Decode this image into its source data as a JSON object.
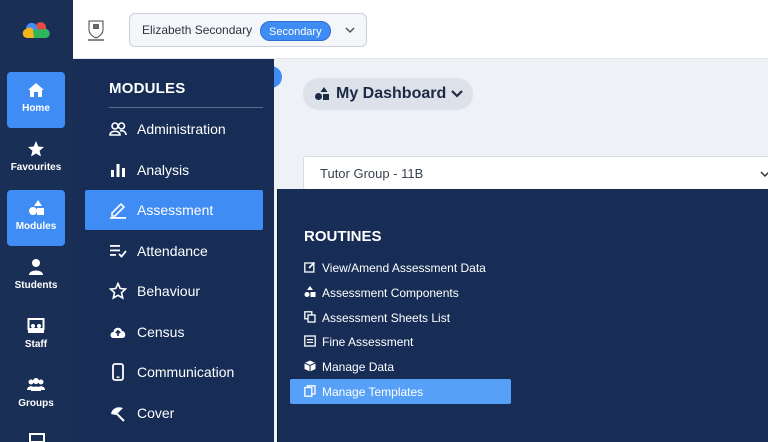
{
  "topbar": {
    "school_name": "Elizabeth Secondary",
    "school_phase": "Secondary"
  },
  "rail": {
    "items": [
      {
        "label": "Home",
        "icon": "home-icon"
      },
      {
        "label": "Favourites",
        "icon": "star-icon"
      },
      {
        "label": "Modules",
        "icon": "shapes-icon"
      },
      {
        "label": "Students",
        "icon": "user-icon"
      },
      {
        "label": "Staff",
        "icon": "staff-icon"
      },
      {
        "label": "Groups",
        "icon": "users-icon"
      }
    ]
  },
  "dashboard": {
    "title": "My Dashboard",
    "tutor_group": "Tutor Group - 11B"
  },
  "modules": {
    "title": "MODULES",
    "items": [
      {
        "label": "Administration",
        "icon": "admin-icon"
      },
      {
        "label": "Analysis",
        "icon": "bar-chart-icon"
      },
      {
        "label": "Assessment",
        "icon": "pencil-icon"
      },
      {
        "label": "Attendance",
        "icon": "checklist-icon"
      },
      {
        "label": "Behaviour",
        "icon": "star-outline-icon"
      },
      {
        "label": "Census",
        "icon": "cloud-upload-icon"
      },
      {
        "label": "Communication",
        "icon": "mobile-icon"
      },
      {
        "label": "Cover",
        "icon": "cover-icon"
      }
    ]
  },
  "routines": {
    "title": "ROUTINES",
    "items": [
      {
        "label": "View/Amend Assessment Data",
        "icon": "edit-icon"
      },
      {
        "label": "Assessment Components",
        "icon": "shapes-icon"
      },
      {
        "label": "Assessment Sheets List",
        "icon": "sheets-icon"
      },
      {
        "label": "Fine Assessment",
        "icon": "list-icon"
      },
      {
        "label": "Manage Data",
        "icon": "box-icon"
      },
      {
        "label": "Manage Templates",
        "icon": "copy-icon"
      }
    ]
  },
  "colors": {
    "navy": "#172d56",
    "accent": "#3f8cf5"
  }
}
